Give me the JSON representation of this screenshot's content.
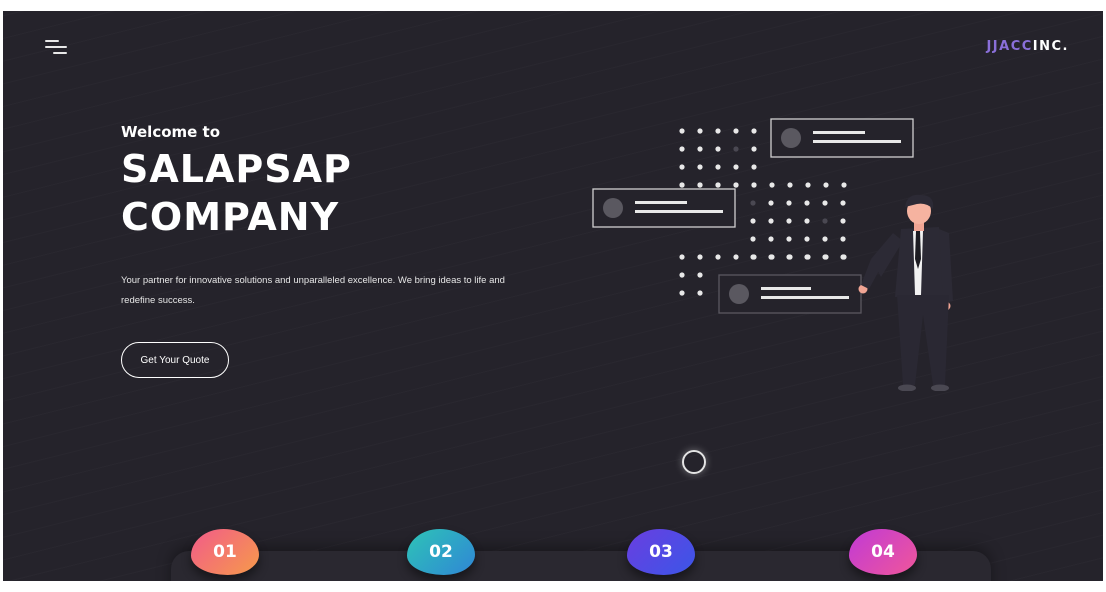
{
  "header": {
    "logo_accent": "JJACC",
    "logo_rest": "INC."
  },
  "hero": {
    "welcome": "Welcome to",
    "title_line1": "SALAPSAP",
    "title_line2": "COMPANY",
    "description": "Your partner for innovative solutions and unparalleled excellence. We bring ideas to life and redefine success.",
    "cta_label": "Get Your Quote"
  },
  "steps": [
    {
      "label": "01"
    },
    {
      "label": "02"
    },
    {
      "label": "03"
    },
    {
      "label": "04"
    }
  ],
  "icons": {
    "menu": "hamburger-menu-icon",
    "loader": "loading-spinner-icon"
  },
  "colors": {
    "background": "#25232b",
    "logo_accent": "#8a6fd9",
    "step1": "#f47a6a",
    "step2": "#2aa7c6",
    "step3": "#4a4ae6",
    "step4": "#d84ab8"
  }
}
